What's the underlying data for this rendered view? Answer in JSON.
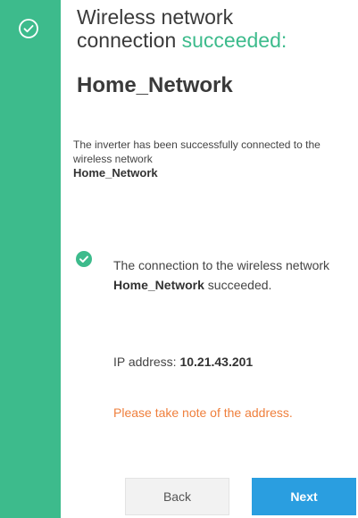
{
  "header": {
    "title_part1": "Wireless network",
    "title_part2": "connection ",
    "title_highlight": "succeeded",
    "title_suffix": ":",
    "network_name": "Home_Network"
  },
  "description": {
    "text": "The inverter has been successfully connected to the wireless network",
    "network": "Home_Network"
  },
  "result": {
    "text_before": "The connection to the wireless network ",
    "network": "Home_Network",
    "text_after": " succeeded."
  },
  "ip": {
    "label": "IP address: ",
    "value": "10.21.43.201"
  },
  "note": "Please take note of the address.",
  "buttons": {
    "back": "Back",
    "next": "Next"
  },
  "icons": {
    "sidebar": "check-circle-outline-icon",
    "status": "check-circle-filled-icon"
  },
  "colors": {
    "accent": "#3dbb8c",
    "primary_button": "#2a9ee0",
    "warning_text": "#ef7f3c"
  }
}
